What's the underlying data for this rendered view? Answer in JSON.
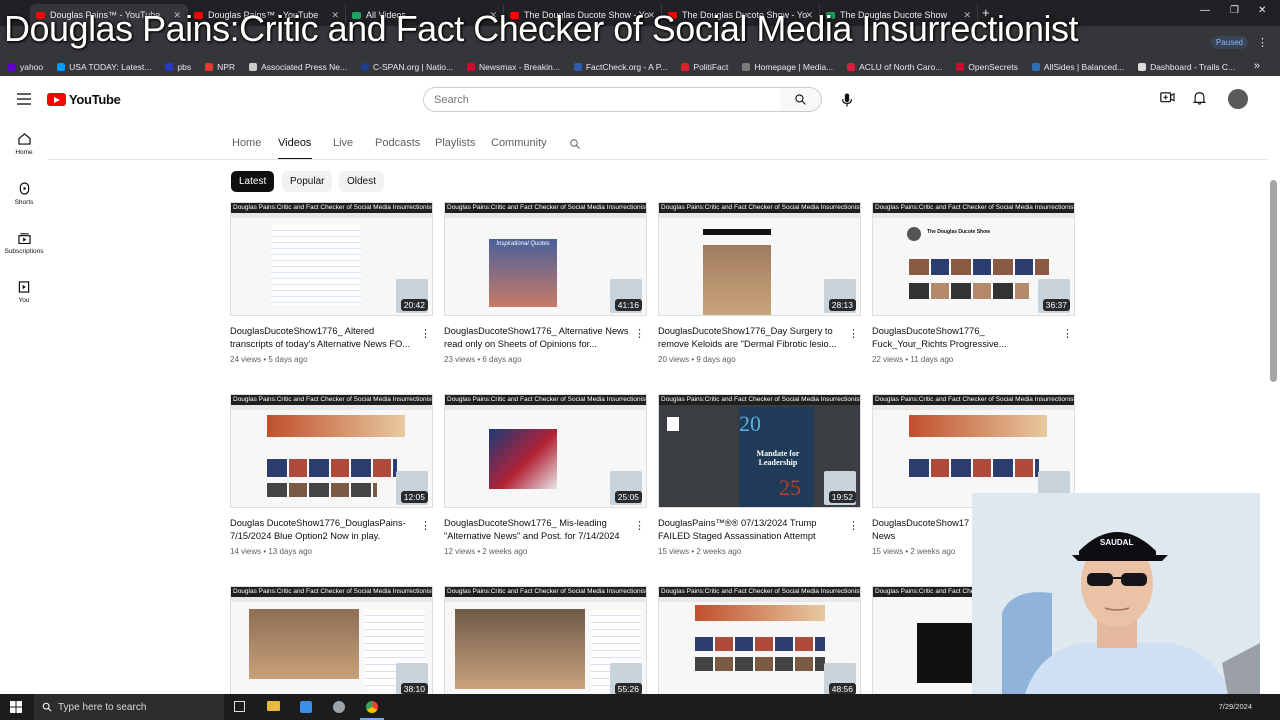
{
  "overlay_title": "Douglas Pains:Critic and Fact Checker of Social Media Insurrectionist",
  "browser": {
    "tabs": [
      {
        "label": "Douglas Pains™ - YouTube",
        "icon": "youtube-icon"
      },
      {
        "label": "Douglas Pains™ - YouTube",
        "icon": "youtube-icon"
      },
      {
        "label": "All Videos",
        "icon": "rumble-icon"
      },
      {
        "label": "The Douglas Ducote Show - Yo",
        "icon": "youtube-icon"
      },
      {
        "label": "The Douglas Ducote Show - Yo",
        "icon": "youtube-icon"
      },
      {
        "label": "The Douglas Ducote Show",
        "icon": "rumble-icon"
      }
    ],
    "profile_label": "Paused",
    "bookmarks": [
      {
        "label": "yahoo",
        "color": "#6001d2"
      },
      {
        "label": "USA TODAY: Latest...",
        "color": "#009bff"
      },
      {
        "label": "pbs",
        "color": "#2638c4"
      },
      {
        "label": "NPR",
        "color": "#e03c31"
      },
      {
        "label": "Associated Press Ne...",
        "color": "#cccccc"
      },
      {
        "label": "C-SPAN.org | Natio...",
        "color": "#1b3f8b"
      },
      {
        "label": "Newsmax - Breakin...",
        "color": "#cf0a2c"
      },
      {
        "label": "FactCheck.org - A P...",
        "color": "#2a5db0"
      },
      {
        "label": "PolitiFact",
        "color": "#d8232a"
      },
      {
        "label": "Homepage | Media...",
        "color": "#7a7a7a"
      },
      {
        "label": "ACLU of North Caro...",
        "color": "#de1b3b"
      },
      {
        "label": "OpenSecrets",
        "color": "#c8102e"
      },
      {
        "label": "AllSides | Balanced...",
        "color": "#2f6fb6"
      },
      {
        "label": "Dashboard - Trails C...",
        "color": "#dddddd"
      }
    ]
  },
  "youtube": {
    "logo_text": "YouTube",
    "search_placeholder": "Search",
    "guide": [
      {
        "label": "Home",
        "icon": "home-icon"
      },
      {
        "label": "Shorts",
        "icon": "shorts-icon"
      },
      {
        "label": "Subscriptions",
        "icon": "subscriptions-icon"
      },
      {
        "label": "You",
        "icon": "you-icon"
      }
    ],
    "channel_tabs": [
      "Home",
      "Videos",
      "Live",
      "Podcasts",
      "Playlists",
      "Community"
    ],
    "active_tab": "Videos",
    "chips": [
      "Latest",
      "Popular",
      "Oldest"
    ],
    "active_chip": "Latest",
    "videos": [
      {
        "title": "DouglasDucoteShow1776_ Altered transcripts of today's Alternative News FO...",
        "views": "24 views",
        "age": "5 days ago",
        "duration": "20:42"
      },
      {
        "title": "DouglasDucoteShow1776_ Alternative News read only on Sheets of Opinions for...",
        "views": "23 views",
        "age": "6 days ago",
        "duration": "41:16"
      },
      {
        "title": "DouglasDucoteShow1776_Day Surgery to remove Keloids are \"Dermal Fibrotic lesio...",
        "views": "20 views",
        "age": "9 days ago",
        "duration": "28:13"
      },
      {
        "title": "DouglasDucoteShow1776_ Fuck_Your_Richts Progressive...",
        "views": "22 views",
        "age": "11 days ago",
        "duration": "36:37"
      },
      {
        "title": "Douglas DucoteShow1776_DouglasPains-7/15/2024 Blue Option2 Now in play.",
        "views": "14 views",
        "age": "13 days ago",
        "duration": "12:05"
      },
      {
        "title": "DouglasDucoteShow1776_ Mis-leading \"Alternative News\" and Post. for 7/14/2024",
        "views": "12 views",
        "age": "2 weeks ago",
        "duration": "25:05"
      },
      {
        "title": "DouglasPains™®® 07/13/2024 Trump FAILED Staged Assassination Attempt",
        "views": "15 views",
        "age": "2 weeks ago",
        "duration": "19:52"
      },
      {
        "title": "DouglasDucoteShow17 Hypocrite. a Fake News",
        "views": "15 views",
        "age": "2 weeks ago",
        "duration": ""
      },
      {
        "title": "",
        "views": "",
        "age": "",
        "duration": "38:10"
      },
      {
        "title": "",
        "views": "",
        "age": "",
        "duration": "55:26"
      },
      {
        "title": "",
        "views": "",
        "age": "",
        "duration": "48:56"
      },
      {
        "title": "",
        "views": "",
        "age": "",
        "duration": ""
      }
    ],
    "thumb_strip_text": "Douglas Pains:Critic and Fact Checker of Social Media Insurrectionist",
    "thumb_captions": {
      "quotes": "Inspirational Quotes",
      "mandate_number_top": "20",
      "mandate_title": "Mandate for Leadership",
      "mandate_number_bottom": "25",
      "show_name": "The Douglas Ducote Show"
    }
  },
  "webcam": {
    "cap_text": "SAUDAL"
  },
  "taskbar": {
    "search_placeholder": "Type here to search",
    "date": "7/29/2024"
  }
}
